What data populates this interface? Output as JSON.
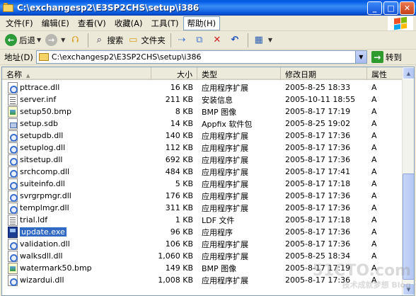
{
  "window": {
    "title": "C:\\exchangesp2\\E3SP2CHS\\setup\\i386"
  },
  "menu": [
    "文件(F)",
    "编辑(E)",
    "查看(V)",
    "收藏(A)",
    "工具(T)",
    "帮助(H)"
  ],
  "toolbar": {
    "back": "后退",
    "search": "搜索",
    "folders": "文件夹"
  },
  "address": {
    "label": "地址(D)",
    "value": "C:\\exchangesp2\\E3SP2CHS\\setup\\i386",
    "go": "转到"
  },
  "columns": {
    "name": "名称",
    "size": "大小",
    "type": "类型",
    "modified": "修改日期",
    "attr": "属性"
  },
  "files": [
    {
      "name": "pttrace.dll",
      "size": "16 KB",
      "type": "应用程序扩展",
      "modified": "2005-8-25 18:33",
      "attr": "A",
      "icon": "dll-icon"
    },
    {
      "name": "server.inf",
      "size": "211 KB",
      "type": "安装信息",
      "modified": "2005-10-11 18:55",
      "attr": "A",
      "icon": "inf-icon"
    },
    {
      "name": "setup50.bmp",
      "size": "8 KB",
      "type": "BMP 图像",
      "modified": "2005-8-17 17:19",
      "attr": "A",
      "icon": "bmp-icon"
    },
    {
      "name": "setup.sdb",
      "size": "14 KB",
      "type": "Appfix 软件包",
      "modified": "2005-8-25 19:02",
      "attr": "A",
      "icon": "sdb-icon"
    },
    {
      "name": "setupdb.dll",
      "size": "140 KB",
      "type": "应用程序扩展",
      "modified": "2005-8-17 17:36",
      "attr": "A",
      "icon": "dll-icon"
    },
    {
      "name": "setuplog.dll",
      "size": "112 KB",
      "type": "应用程序扩展",
      "modified": "2005-8-17 17:36",
      "attr": "A",
      "icon": "dll-icon"
    },
    {
      "name": "sitsetup.dll",
      "size": "692 KB",
      "type": "应用程序扩展",
      "modified": "2005-8-17 17:36",
      "attr": "A",
      "icon": "dll-icon"
    },
    {
      "name": "srchcomp.dll",
      "size": "484 KB",
      "type": "应用程序扩展",
      "modified": "2005-8-17 17:41",
      "attr": "A",
      "icon": "dll-icon"
    },
    {
      "name": "suiteinfo.dll",
      "size": "5 KB",
      "type": "应用程序扩展",
      "modified": "2005-8-17 17:18",
      "attr": "A",
      "icon": "dll-icon"
    },
    {
      "name": "svrgrpmgr.dll",
      "size": "176 KB",
      "type": "应用程序扩展",
      "modified": "2005-8-17 17:36",
      "attr": "A",
      "icon": "dll-icon"
    },
    {
      "name": "templmgr.dll",
      "size": "311 KB",
      "type": "应用程序扩展",
      "modified": "2005-8-17 17:36",
      "attr": "A",
      "icon": "dll-icon"
    },
    {
      "name": "trial.ldf",
      "size": "1 KB",
      "type": "LDF 文件",
      "modified": "2005-8-17 17:18",
      "attr": "A",
      "icon": "ldf-icon"
    },
    {
      "name": "update.exe",
      "size": "96 KB",
      "type": "应用程序",
      "modified": "2005-8-17 17:36",
      "attr": "A",
      "icon": "exe-icon",
      "selected": true
    },
    {
      "name": "validation.dll",
      "size": "106 KB",
      "type": "应用程序扩展",
      "modified": "2005-8-17 17:36",
      "attr": "A",
      "icon": "dll-icon"
    },
    {
      "name": "walksdll.dll",
      "size": "1,060 KB",
      "type": "应用程序扩展",
      "modified": "2005-8-25 18:34",
      "attr": "A",
      "icon": "dll-icon"
    },
    {
      "name": "watermark50.bmp",
      "size": "149 KB",
      "type": "BMP 图像",
      "modified": "2005-8-17 17:19",
      "attr": "A",
      "icon": "bmp-icon"
    },
    {
      "name": "wizardui.dll",
      "size": "1,008 KB",
      "type": "应用程序扩展",
      "modified": "2005-8-17 17:36",
      "attr": "A",
      "icon": "dll-icon"
    }
  ],
  "watermark": {
    "line1": "51CTO.com",
    "line2": "技术成就梦想 Blog"
  }
}
